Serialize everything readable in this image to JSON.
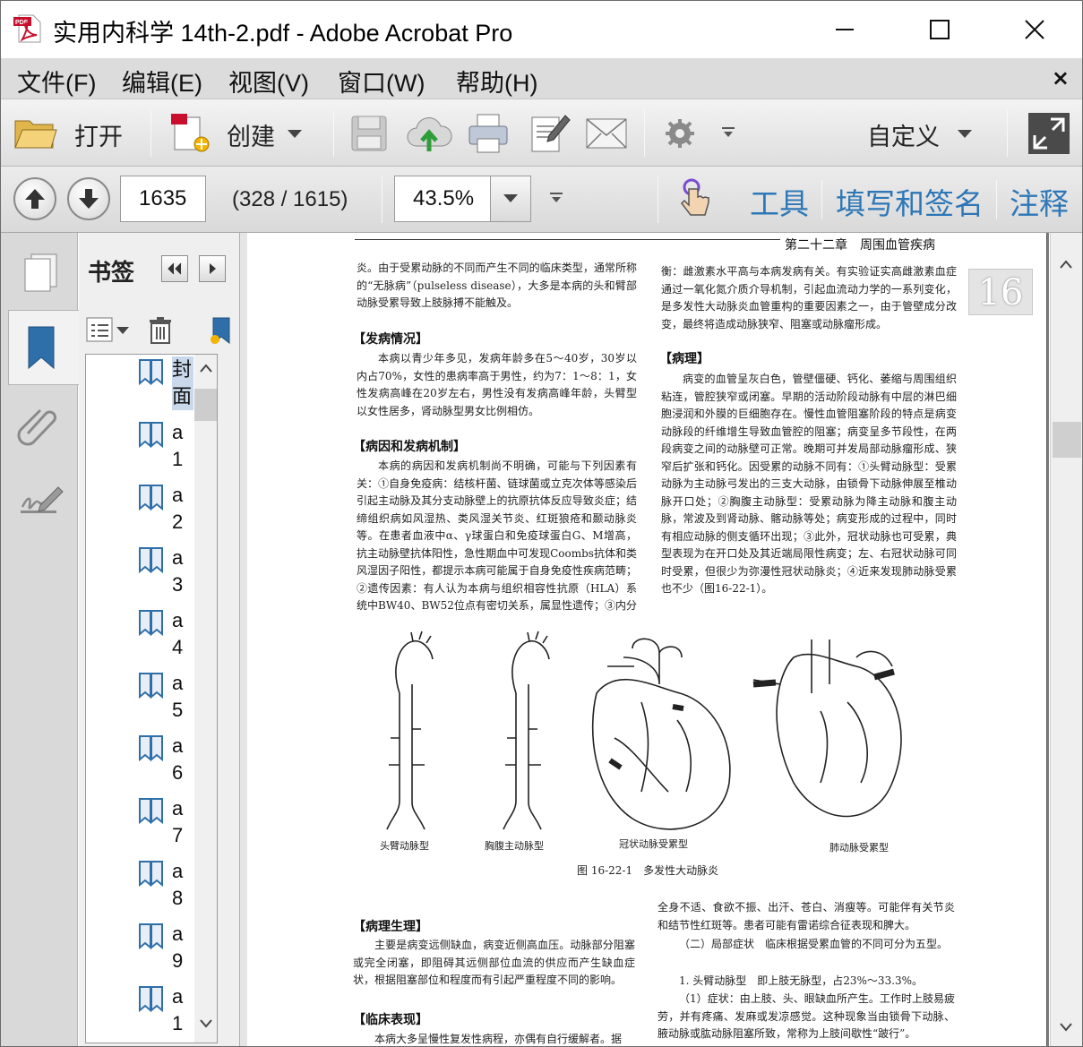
{
  "window": {
    "title": "实用内科学 14th-2.pdf - Adobe Acrobat Pro"
  },
  "menu": {
    "items": [
      "文件(F)",
      "编辑(E)",
      "视图(V)",
      "窗口(W)",
      "帮助(H)"
    ],
    "close_glyph": "×"
  },
  "toolbar": {
    "open_label": "打开",
    "create_label": "创建",
    "customize_label": "自定义"
  },
  "nav": {
    "page_number": "1635",
    "page_info": "(328 / 1615)",
    "zoom": "43.5%",
    "tools_label": "工具",
    "fill_sign_label": "填写和签名",
    "comment_label": "注释"
  },
  "bookmarks": {
    "title": "书签",
    "items": [
      "封面",
      "a1",
      "a2",
      "a3",
      "a4",
      "a5",
      "a6",
      "a7",
      "a8",
      "a9",
      "a1"
    ]
  },
  "document": {
    "running_head": "第二十二章　周围血管疾病",
    "page_tab": "16",
    "left_col": {
      "p0": "炎。由于受累动脉的不同而产生不同的临床类型，通常所称的“无脉病”（pulseless disease），大多是本病的头和臂部动脉受累导致上肢脉搏不能触及。",
      "h1": "【发病情况】",
      "p1": "本病以青少年多见，发病年龄多在5～40岁，30岁以内占70%，女性的患病率高于男性，约为7：1～8：1，女性发病高峰在20岁左右，男性没有发病高峰年龄，头臂型以女性居多，肾动脉型男女比例相仿。",
      "h2": "【病因和发病机制】",
      "p2": "本病的病因和发病机制尚不明确，可能与下列因素有关：①自身免疫病：结核杆菌、链球菌或立克次体等感染后引起主动脉及其分支动脉壁上的抗原抗体反应导致炎症；结缔组织病如风湿热、类风湿关节炎、红斑狼疮和颞动脉炎等。在患者血液中α、γ球蛋白和免疫球蛋白G、M增高，抗主动脉壁抗体阳性，急性期血中可发现Coombs抗体和类风湿因子阳性，都提示本病可能属于自身免疫性疾病范畴；②遗传因素：有人认为本病与组织相容性抗原（HLA）系统中BW40、BW52位点有密切关系，属显性遗传；③内分泌"
    },
    "right_col": {
      "p0": "衡：雌激素水平高与本病发病有关。有实验证实高雌激素血症通过一氧化氮介质介导机制，引起血流动力学的一系列变化，是多发性大动脉炎血管重构的重要因素之一，由于管壁成分改变，最终将造成动脉狭窄、阻塞或动脉瘤形成。",
      "h1": "【病理】",
      "p1": "病变的血管呈灰白色，管壁僵硬、钙化、萎缩与周围组织粘连，管腔狭窄或闭塞。早期的活动阶段动脉有中层的淋巴细胞浸润和外膜的巨细胞存在。慢性血管阻塞阶段的特点是病变动脉段的纤维增生导致血管腔的阻塞；病变呈多节段性，在两段病变之间的动脉壁可正常。晚期可并发局部动脉瘤形成、狭窄后扩张和钙化。因受累的动脉不同有：①头臂动脉型：受累动脉为主动脉弓发出的三支大动脉，由锁骨下动脉伸展至椎动脉开口处；②胸腹主动脉型：受累动脉为降主动脉和腹主动脉，常波及到肾动脉、髂动脉等处；病变形成的过程中，同时有相应动脉的侧支循环出现；③此外，冠状动脉也可受累，典型表现为在开口处及其近端局限性病变；左、右冠状动脉可同时受累，但很少为弥漫性冠状动脉炎；④近来发现肺动脉受累也不少（图16-22-1）。"
    },
    "figure": {
      "captions": [
        "头臂动脉型",
        "胸腹主动脉型",
        "冠状动脉受累型",
        "肺动脉受累型"
      ],
      "title": "图 16-22-1　多发性大动脉炎"
    },
    "bottom_left": {
      "h1": "【病理生理】",
      "p1": "主要是病变远侧缺血，病变近侧高血压。动脉部分阻塞或完全闭塞，即阻碍其远侧部位血流的供应而产生缺血症状，根据阻塞部位和程度而有引起严重程度不同的影响。",
      "h2": "【临床表现】",
      "p2": "本病大多呈慢性复发性病程，亦偶有自行缓解者。据"
    },
    "bottom_right": {
      "p1": "全身不适、食欲不振、出汗、苍白、消瘦等。可能伴有关节炎和结节性红斑等。患者可能有雷诺综合征表现和脾大。",
      "p2": "（二）局部症状　临床根据受累血管的不同可分为五型。",
      "p3": "1. 头臂动脉型　即上肢无脉型，占23%～33.3%。",
      "p4": "（1）症状：由上肢、头、眼缺血所产生。工作时上肢易疲劳，并有疼痛、发麻或发凉感觉。这种现象当由锁骨下动脉、腋动脉或肱动脉阻塞所致，常称为上肢间歇性“跛行”。"
    }
  }
}
